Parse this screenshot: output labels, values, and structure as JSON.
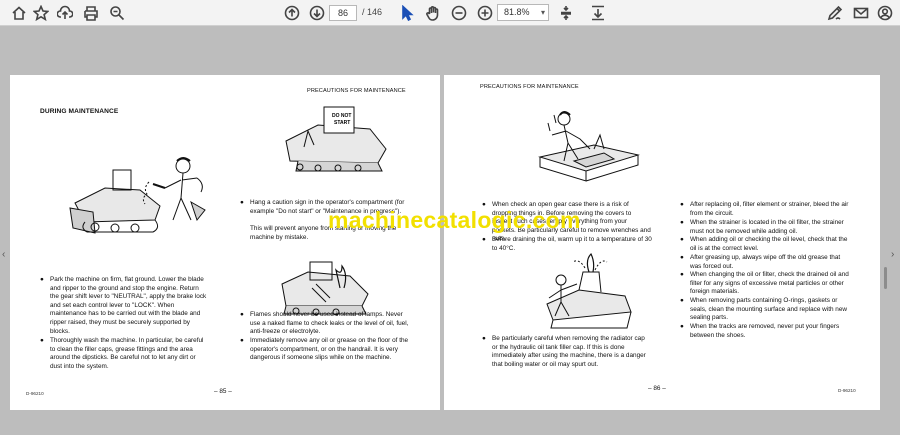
{
  "toolbar": {
    "current_page": "86",
    "page_total": "/ 146",
    "zoom": "81.8%",
    "icons": [
      "home-icon",
      "star-icon",
      "upload-icon",
      "print-icon",
      "zoom-search-icon",
      "page-up-icon",
      "page-down-icon",
      "select-cursor-icon",
      "hand-icon",
      "zoom-out-icon",
      "zoom-in-icon",
      "fit-icon",
      "download-icon",
      "sign-icon",
      "mail-icon",
      "account-icon"
    ]
  },
  "left_page": {
    "running_head": "PRECAUTIONS FOR MAINTENANCE",
    "section_title": "DURING MAINTENANCE",
    "sign_text_1": "DO NOT",
    "sign_text_2": "START",
    "col1": [
      "Park the machine on firm, flat ground. Lower the blade and ripper to the ground and stop the engine. Return the gear shift lever to \"NEUTRAL\", apply the brake lock and set each control lever to \"LOCK\". When maintenance has to be carried out with the blade and ripper raised, they must be securely supported by blocks.",
      "Thoroughly wash the machine. In particular, be careful to clean the filler caps, grease fittings and the area around the dipsticks. Be careful not to let any dirt or dust into the system."
    ],
    "col2": [
      "Hang a caution sign in the operator's compartment (for example \"Do not start\" or \"Maintenance in progress\").",
      "This will prevent anyone from starting or moving the machine by mistake.",
      "Flames should never be used instead of lamps. Never use a naked flame to check leaks or the level of oil, fuel, anti-freeze or electrolyte.",
      "Immediately remove any oil or grease on the floor of the operator's compartment, or on the handrail. It is very dangerous if someone slips while on the machine."
    ],
    "page_number": "– 85 –",
    "doc_code": "D-96210"
  },
  "right_page": {
    "running_head": "PRECAUTIONS FOR MAINTENANCE",
    "col1": [
      "When check an open gear case there is a risk of dropping things in. Before removing the covers to inspect such cases, empty everything from your pockets. Be particularly careful to remove wrenches and nuts.",
      "Before draining the oil, warm up it to a temperature of 30 to 40°C.",
      "Be particularly careful when removing the radiator cap or the hydraulic oil tank filler cap. If this is done immediately after using the machine, there is a danger that boiling water or oil may spurt out."
    ],
    "col2": [
      "After replacing oil, filter element or strainer, bleed the air from the circuit.",
      "When the strainer is located in the oil filter, the strainer must not be removed while adding oil.",
      "When adding oil or checking the oil level, check that the oil is at the correct level.",
      "After greasing up, always wipe off the old grease that was forced out.",
      "When changing the oil or filter, check the drained oil and filter for any signs of excessive metal particles or other foreign materials.",
      "When removing parts containing O-rings, gaskets or seals, clean the mounting surface and replace with new sealing parts.",
      "When the tracks are removed, never put your fingers between the shoes."
    ],
    "page_number": "– 86 –",
    "doc_code": "D-96210"
  },
  "watermark": "machinecatalogic.com"
}
